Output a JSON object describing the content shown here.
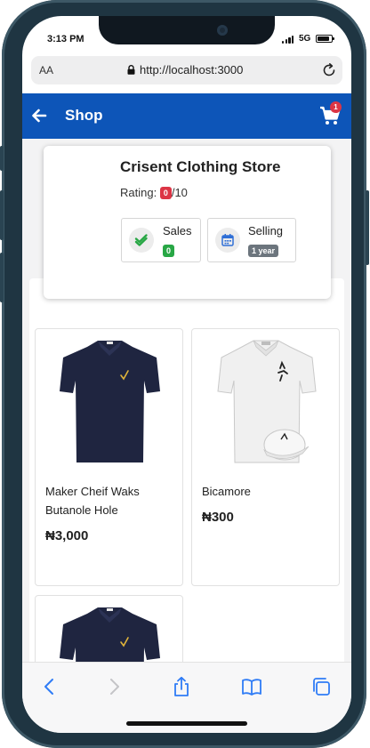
{
  "status": {
    "time": "3:13 PM",
    "network": "5G"
  },
  "browser": {
    "text_size": "AA",
    "url": "http://localhost:3000"
  },
  "header": {
    "title": "Shop",
    "cart_count": "1"
  },
  "store": {
    "name": "Crisent Clothing Store",
    "rating_label": "Rating:",
    "rating_value": "0",
    "rating_max": "/10",
    "sales_label": "Sales",
    "sales_value": "0",
    "selling_label": "Selling",
    "selling_value": "1 year"
  },
  "products": [
    {
      "name": "Maker Cheif Waks Butanole Hole",
      "price": "₦3,000",
      "color": "#1f2540"
    },
    {
      "name": "Bicamore",
      "price": "₦300",
      "color": "#eeeeee"
    },
    {
      "name": "",
      "price": "",
      "color": "#1f2540"
    }
  ],
  "colors": {
    "header": "#0d55b8",
    "badge_red": "#dc3545",
    "badge_green": "#28a745",
    "badge_gray": "#6c757d"
  },
  "toolbar": [
    "back-icon",
    "forward-icon",
    "share-icon",
    "bookmarks-icon",
    "tabs-icon"
  ]
}
